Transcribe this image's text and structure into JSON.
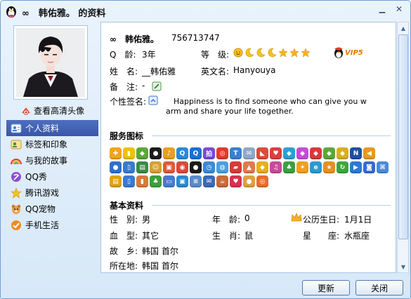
{
  "window": {
    "title": "∞　韩佑雅。 的资料"
  },
  "sidebar": {
    "hd_link": "查看高清头像",
    "items": [
      {
        "label": "个人资料",
        "icon": "person-card-icon",
        "active": true
      },
      {
        "label": "标签和印象",
        "icon": "tag-icon",
        "active": false
      },
      {
        "label": "与我的故事",
        "icon": "rainbow-icon",
        "active": false
      },
      {
        "label": "QQ秀",
        "icon": "qq-show-icon",
        "active": false
      },
      {
        "label": "腾讯游戏",
        "icon": "game-icon",
        "active": false
      },
      {
        "label": "QQ宠物",
        "icon": "pet-icon",
        "active": false
      },
      {
        "label": "手机生活",
        "icon": "check-icon",
        "active": false
      }
    ]
  },
  "profile": {
    "nickname": "∞　韩佑雅。",
    "qq_number": "756713747",
    "qage_label": "Q　龄:",
    "qage_value": "3年",
    "level_label": "等　级:",
    "vip": "VIP5",
    "name_label": "姓　名:",
    "name_value": "__韩佑雅",
    "en_name_label": "英文名:",
    "en_name_value": "Hanyouya",
    "note_label": "备　注:",
    "note_value": "-",
    "signature_label": "个性签名:",
    "signature_line1": "Happiness is to find someone who can give you w",
    "signature_line2": "arm and share your life together."
  },
  "service_section": {
    "title": "服务图标"
  },
  "basic_section": {
    "title": "基本资料",
    "gender_label": "性　别:",
    "gender_value": "男",
    "age_label": "年　龄:",
    "age_value": "0",
    "birthday_label": "公历生日:",
    "birthday_value": "1月1日",
    "blood_label": "血　型:",
    "blood_value": "其它",
    "zodiac_label": "生　肖:",
    "zodiac_value": "鼠",
    "constellation_label": "星　　座:",
    "constellation_value": "水瓶座",
    "hometown_label": "故　乡:",
    "hometown_value": "韩国 首尔",
    "location_label": "所在地:",
    "location_value": "韩国 首尔"
  },
  "buttons": {
    "refresh": "更新",
    "close": "关闭"
  },
  "colors": {
    "accent": "#3a58a8",
    "vip": "#e07800"
  }
}
